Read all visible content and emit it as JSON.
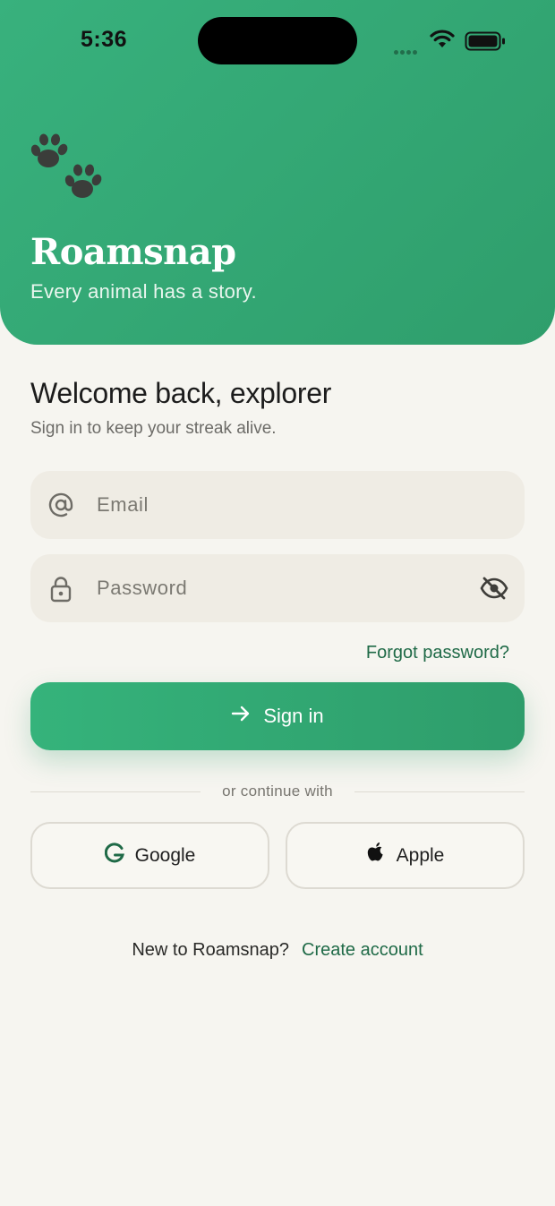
{
  "status_bar": {
    "time": "5:36"
  },
  "brand": {
    "title": "Roamsnap",
    "tagline": "Every animal has a story."
  },
  "form": {
    "heading": "Welcome back, explorer",
    "subtitle": "Sign in to keep your streak alive.",
    "email_placeholder": "Email",
    "password_placeholder": "Password",
    "forgot_label": "Forgot password?",
    "signin_label": "Sign in"
  },
  "divider": {
    "label": "or continue with"
  },
  "social": {
    "google_label": "Google",
    "apple_label": "Apple"
  },
  "footer": {
    "question": "New to Roamsnap?",
    "create_label": "Create account"
  },
  "colors": {
    "accent": "#33a873",
    "accent_dark": "#1f6a47",
    "background": "#f6f5f0",
    "field": "#efece4"
  },
  "icons": [
    "paw-prints-icon",
    "at-sign-icon",
    "lock-icon",
    "eye-off-icon",
    "arrow-right-icon",
    "google-g-icon",
    "apple-logo-icon",
    "wifi-icon",
    "battery-icon",
    "signal-icon"
  ]
}
